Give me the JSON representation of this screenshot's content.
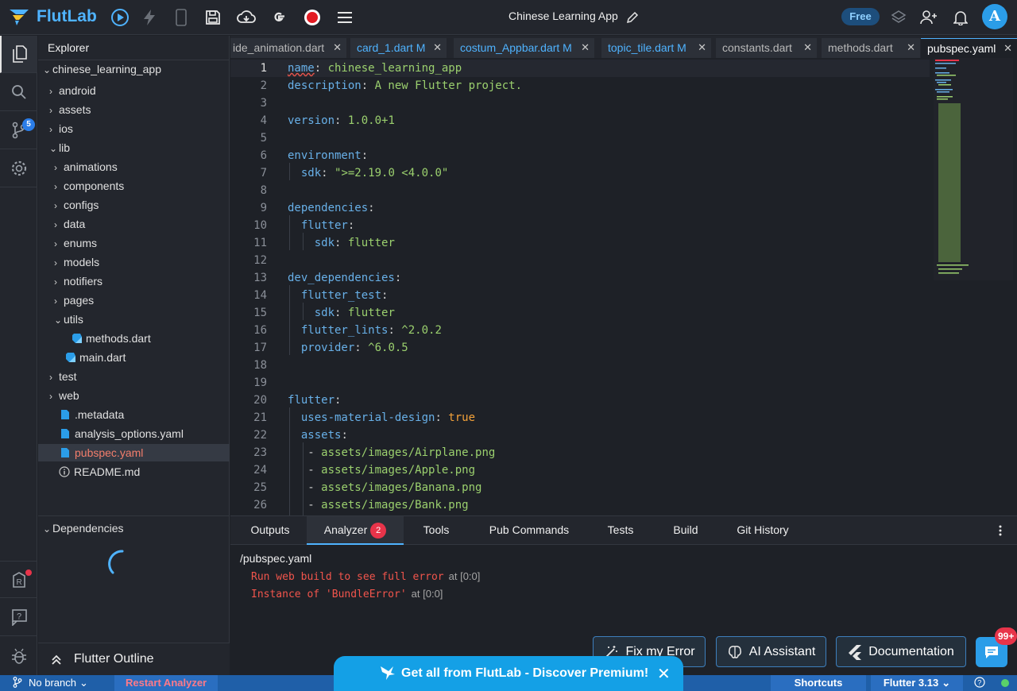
{
  "app": {
    "logo_text": "FlutLab",
    "title": "Chinese Learning App",
    "plan_badge": "Free",
    "avatar_letter": "A"
  },
  "activity": {
    "git_badge": "5"
  },
  "explorer": {
    "title": "Explorer",
    "root": "chinese_learning_app",
    "items": [
      {
        "label": "android"
      },
      {
        "label": "assets"
      },
      {
        "label": "ios"
      },
      {
        "label": "lib"
      },
      {
        "label": "animations"
      },
      {
        "label": "components"
      },
      {
        "label": "configs"
      },
      {
        "label": "data"
      },
      {
        "label": "enums"
      },
      {
        "label": "models"
      },
      {
        "label": "notifiers"
      },
      {
        "label": "pages"
      },
      {
        "label": "utils"
      },
      {
        "label": "methods.dart"
      },
      {
        "label": "main.dart"
      },
      {
        "label": "test"
      },
      {
        "label": "web"
      },
      {
        "label": ".metadata"
      },
      {
        "label": "analysis_options.yaml"
      },
      {
        "label": "pubspec.yaml"
      },
      {
        "label": "README.md"
      }
    ],
    "dependencies_label": "Dependencies",
    "outline_label": "Flutter Outline"
  },
  "tabs": [
    {
      "label": "ide_animation.dart"
    },
    {
      "label": "card_1.dart M"
    },
    {
      "label": "costum_Appbar.dart M"
    },
    {
      "label": "topic_tile.dart M"
    },
    {
      "label": "constants.dart"
    },
    {
      "label": "methods.dart"
    },
    {
      "label": "pubspec.yaml"
    }
  ],
  "editor": {
    "line_numbers": [
      "1",
      "2",
      "3",
      "4",
      "5",
      "6",
      "7",
      "8",
      "9",
      "10",
      "11",
      "12",
      "13",
      "14",
      "15",
      "16",
      "17",
      "18",
      "19",
      "20",
      "21",
      "22",
      "23",
      "24",
      "25",
      "26"
    ],
    "code": {
      "l1_key": "name",
      "l1_val": "chinese_learning_app",
      "l2_key": "description",
      "l2_val": "A new Flutter project.",
      "l4_key": "version",
      "l4_val": "1.0.0+1",
      "l6_key": "environment",
      "l7_key": "sdk",
      "l7_val": "\">=2.19.0 <4.0.0\"",
      "l9_key": "dependencies",
      "l10_key": "flutter",
      "l11_key": "sdk",
      "l11_val": "flutter",
      "l13_key": "dev_dependencies",
      "l14_key": "flutter_test",
      "l15_key": "sdk",
      "l15_val": "flutter",
      "l16_key": "flutter_lints",
      "l16_val": "^2.0.2",
      "l17_key": "provider",
      "l17_val": "^6.0.5",
      "l20_key": "flutter",
      "l21_key": "uses-material-design",
      "l21_val": "true",
      "l22_key": "assets",
      "l23_val": "assets/images/Airplane.png",
      "l24_val": "assets/images/Apple.png",
      "l25_val": "assets/images/Banana.png",
      "l26_val": "assets/images/Bank.png"
    }
  },
  "panel": {
    "tabs": [
      "Outputs",
      "Analyzer",
      "Tools",
      "Pub Commands",
      "Tests",
      "Build",
      "Git History"
    ],
    "analyzer_count": "2",
    "file": "/pubspec.yaml",
    "errors": [
      {
        "message": "Run web build to see full error",
        "location": "at [0:0]"
      },
      {
        "message": "Instance of 'BundleError'",
        "location": "at [0:0]"
      }
    ],
    "buttons": {
      "fix": "Fix my Error",
      "ai": "AI Assistant",
      "docs": "Documentation"
    },
    "chat_badge": "99+"
  },
  "statusbar": {
    "branch": "No branch",
    "restart": "Restart Analyzer",
    "shortcuts": "Shortcuts",
    "flutter_version": "Flutter 3.13"
  },
  "promo": {
    "text": "Get all from FlutLab - Discover Premium!"
  },
  "colors": {
    "accent": "#2b9de8",
    "error": "#f2554c",
    "yaml_key": "#68b0e8",
    "yaml_string": "#9bd06e",
    "yaml_bool": "#f4a23a",
    "statusbar": "#1f5fa8"
  }
}
